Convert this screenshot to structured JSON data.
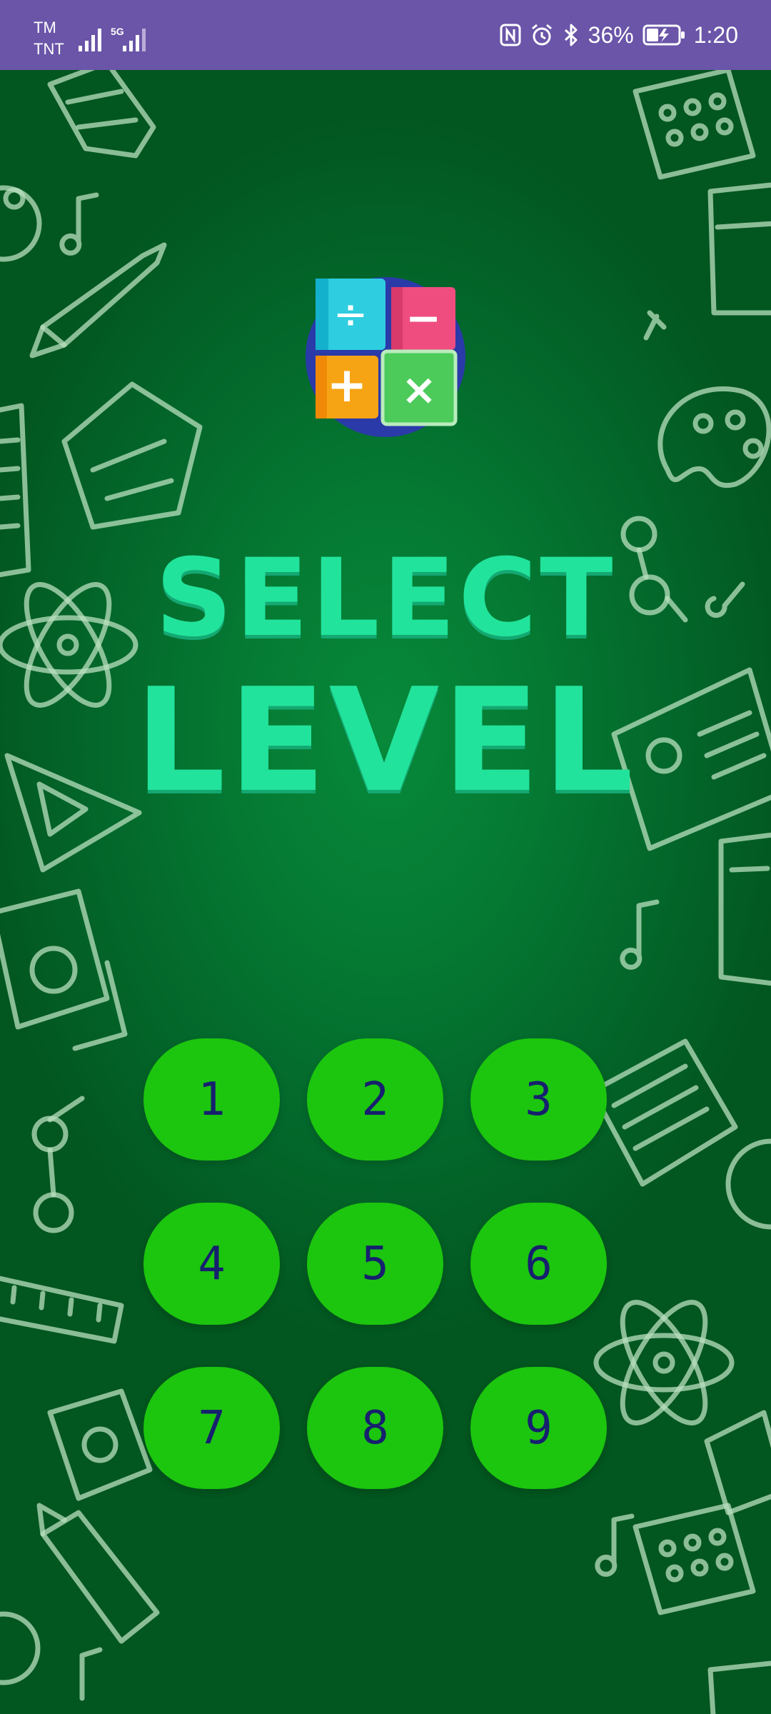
{
  "status_bar": {
    "carrier_1": "TM",
    "carrier_2": "TNT",
    "network_type": "5G",
    "battery_percent": "36%",
    "time": "1:20",
    "icons": [
      "signal-icon",
      "nfc-icon",
      "alarm-icon",
      "bluetooth-icon",
      "battery-charging-icon"
    ]
  },
  "header": {
    "title_line_1": "SELECT",
    "title_line_2": "LEVEL"
  },
  "logo": {
    "symbols": [
      "÷",
      "−",
      "+",
      "×"
    ]
  },
  "levels": [
    "1",
    "2",
    "3",
    "4",
    "5",
    "6",
    "7",
    "8",
    "9"
  ],
  "colors": {
    "status_bar": "#6a55a8",
    "background": "#057a33",
    "title": "#22e39b",
    "level_button": "#1cc50e",
    "level_text": "#16206e"
  }
}
